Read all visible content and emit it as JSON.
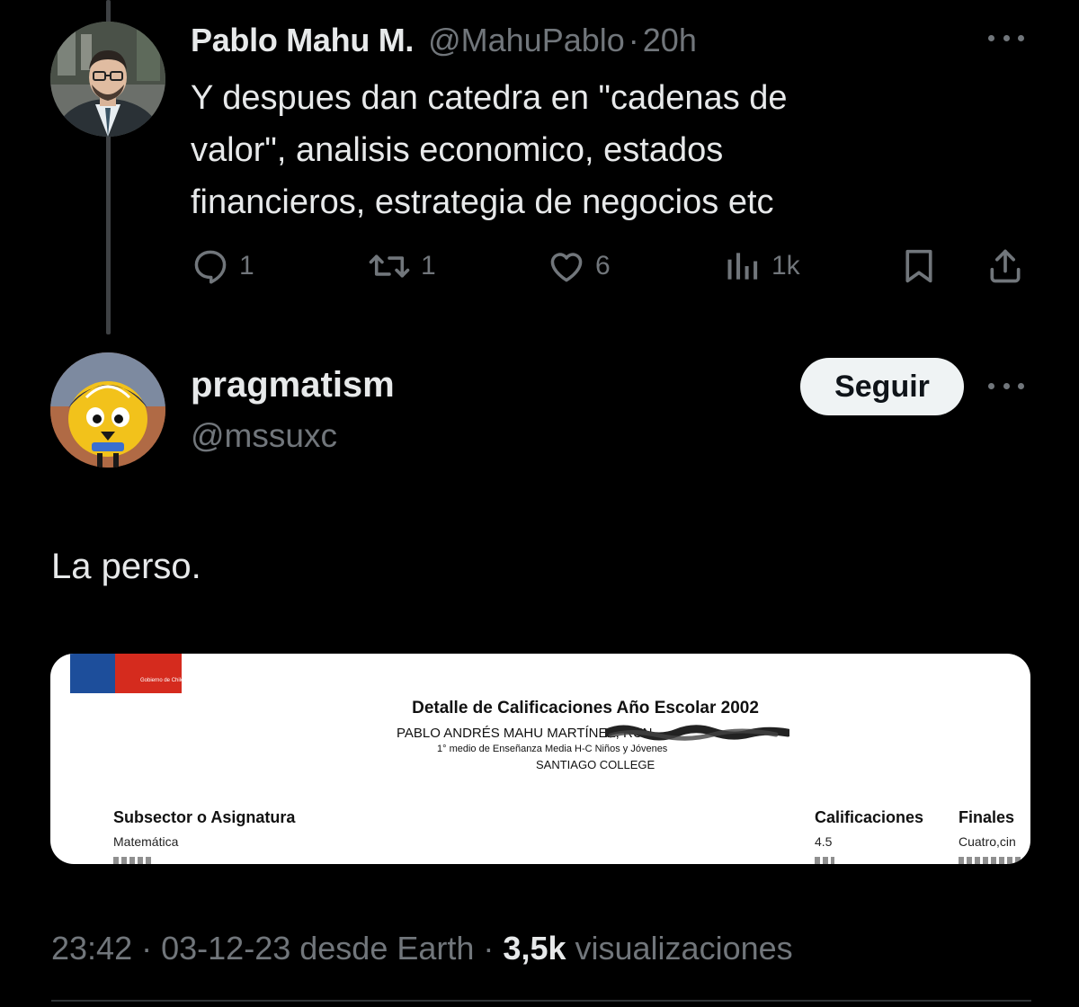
{
  "parent_tweet": {
    "author_name": "Pablo Mahu M.",
    "author_handle": "@MahuPablo",
    "separator": "·",
    "time": "20h",
    "text_lines": [
      "Y despues dan catedra en \"cadenas de",
      "valor\", analisis economico, estados",
      "financieros, estrategia de negocios etc"
    ],
    "actions": {
      "replies": "1",
      "retweets": "1",
      "likes": "6",
      "views": "1k"
    },
    "icons": [
      "reply-icon",
      "retweet-icon",
      "like-icon",
      "views-icon",
      "bookmark-icon",
      "share-icon",
      "more-icon"
    ]
  },
  "quote_tweet": {
    "author_name": "pragmatism",
    "author_handle": "@mssuxc",
    "follow_label": "Seguir",
    "text": "La perso."
  },
  "media_document": {
    "gov_logo_text": "Gobierno de Chile",
    "title": "Detalle de Calificaciones Año Escolar 2002",
    "student_line": "PABLO ANDRÉS MAHU MARTÍNEZ, RUN",
    "course_line": "1° medio de Enseñanza Media H-C Niños y Jóvenes",
    "school": "SANTIAGO COLLEGE",
    "columns": {
      "subject": "Subsector o Asignatura",
      "grades": "Calificaciones",
      "finals": "Finales"
    },
    "rows": [
      {
        "subject": "Matemática",
        "grade": "4.5",
        "final": "Cuatro,cin"
      }
    ]
  },
  "meta": {
    "time": "23:42",
    "sep1": "·",
    "date": "03-12-23",
    "source": "desde Earth",
    "sep2": "·",
    "views_count": "3,5k",
    "views_label": "visualizaciones"
  },
  "colors": {
    "background": "#000000",
    "text_primary": "#e7e9ea",
    "text_secondary": "#71767b",
    "follow_bg": "#eff3f4",
    "thread_line": "#3e4144"
  }
}
